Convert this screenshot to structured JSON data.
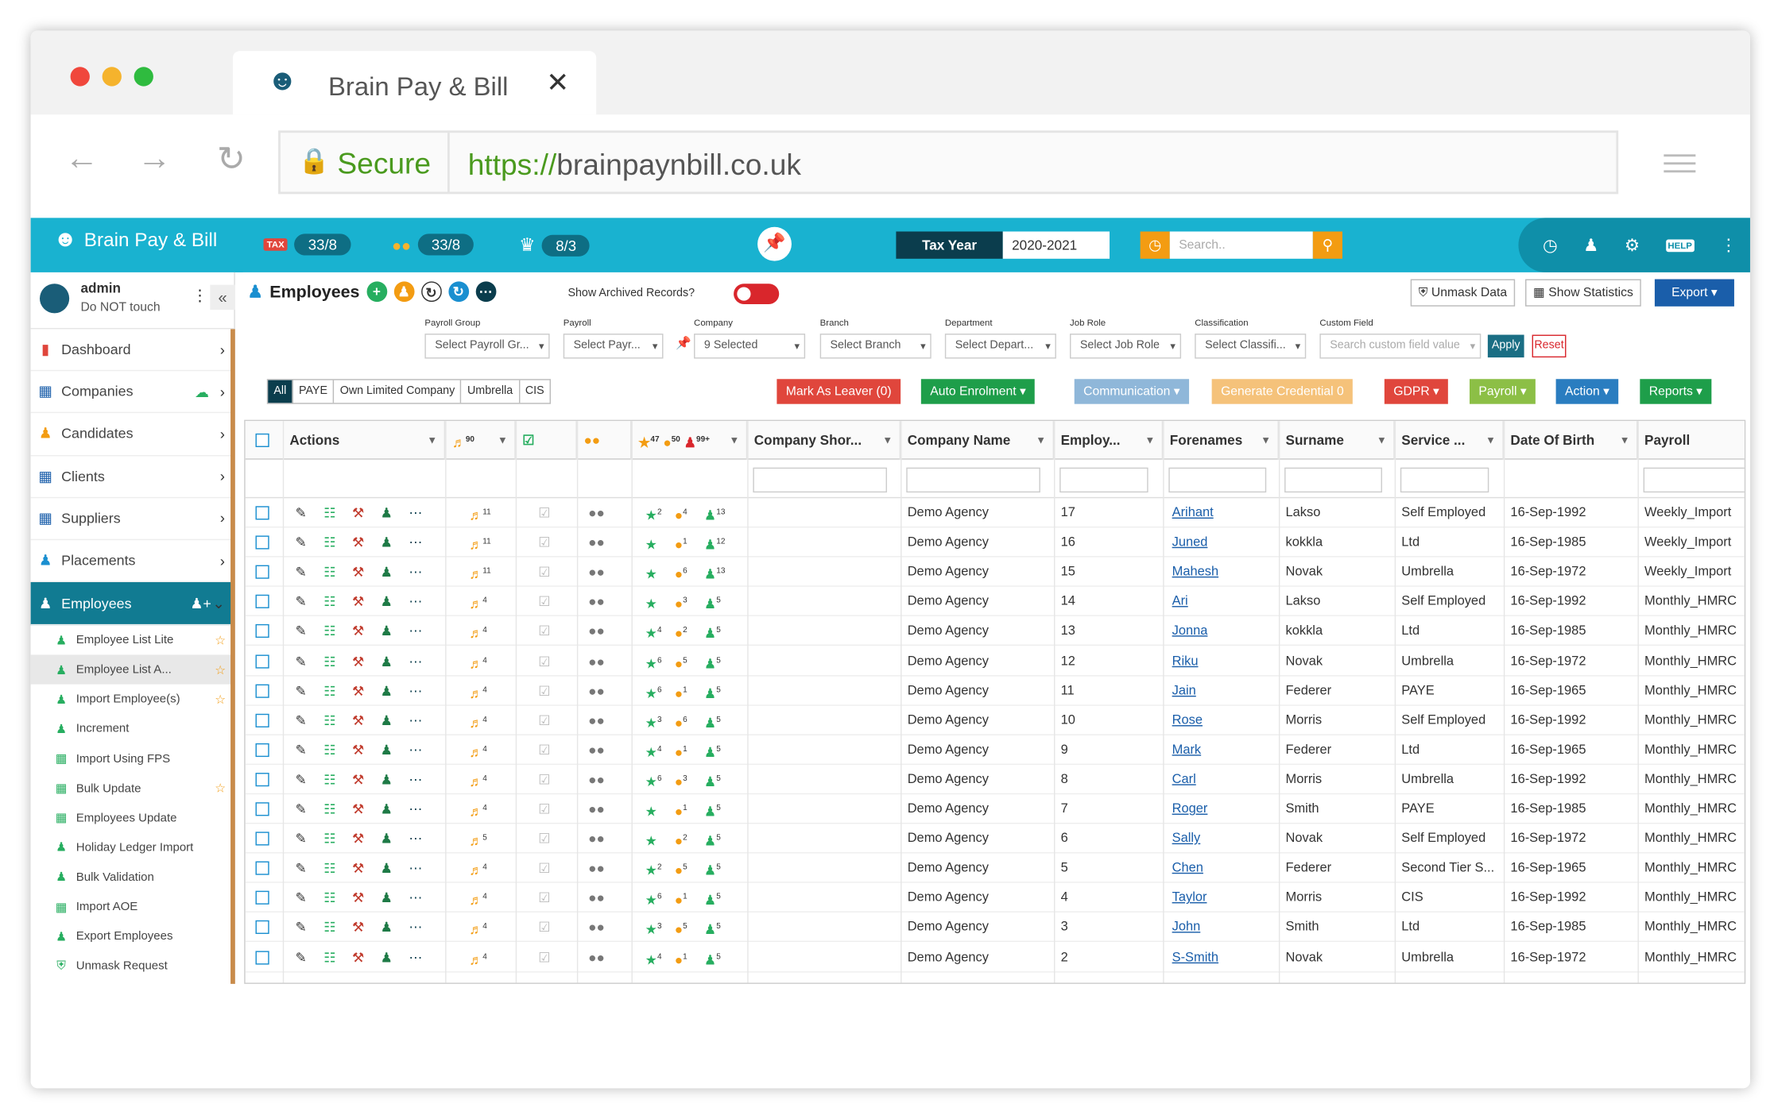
{
  "browser": {
    "tab_title": "Brain Pay & Bill",
    "tab_close": "✕",
    "secure_label": "Secure",
    "url_scheme": "https://",
    "url_host": "brainpaynbill.co.uk"
  },
  "app": {
    "logo_text": "Brain Pay & Bill",
    "counters": [
      {
        "icon": "tax-icon",
        "value": "33/8"
      },
      {
        "icon": "coins-icon",
        "value": "33/8"
      },
      {
        "icon": "crown-icon",
        "value": "8/3"
      }
    ],
    "tax_year_label": "Tax Year",
    "tax_year_value": "2020-2021",
    "search_placeholder": "Search..",
    "top_icons": [
      "timer-icon",
      "user-plus-icon",
      "gear-icon",
      "help-icon",
      "kebab-icon"
    ]
  },
  "user": {
    "name": "admin",
    "role": "Do NOT touch"
  },
  "sidebar": {
    "items": [
      {
        "label": "Dashboard",
        "icon": "chart-icon"
      },
      {
        "label": "Companies",
        "icon": "building-icon"
      },
      {
        "label": "Candidates",
        "icon": "candidates-icon"
      },
      {
        "label": "Clients",
        "icon": "client-icon"
      },
      {
        "label": "Suppliers",
        "icon": "supplier-icon"
      },
      {
        "label": "Placements",
        "icon": "placement-icon"
      },
      {
        "label": "Employees",
        "icon": "employees-icon"
      }
    ],
    "sub_items": [
      {
        "label": "Employee List Lite",
        "star": true
      },
      {
        "label": "Employee List A...",
        "star": true
      },
      {
        "label": "Import Employee(s)",
        "star": true
      },
      {
        "label": "Increment",
        "star": false
      },
      {
        "label": "Import Using FPS",
        "star": false
      },
      {
        "label": "Bulk Update",
        "star": true
      },
      {
        "label": "Employees Update",
        "star": false
      },
      {
        "label": "Holiday Ledger Import",
        "star": false
      },
      {
        "label": "Bulk Validation",
        "star": false
      },
      {
        "label": "Import AOE",
        "star": false
      },
      {
        "label": "Export Employees",
        "star": false
      },
      {
        "label": "Unmask Request",
        "star": false
      }
    ]
  },
  "page": {
    "title": "Employees",
    "archived_label": "Show Archived Records?",
    "unmask_label": "Unmask Data",
    "statistics_label": "Show Statistics",
    "export_label": "Export ▾"
  },
  "filters": [
    {
      "label": "Payroll Group",
      "value": "Select Payroll Gr..."
    },
    {
      "label": "Payroll",
      "value": "Select Payr..."
    },
    {
      "label": "Company",
      "value": "9 Selected"
    },
    {
      "label": "Branch",
      "value": "Select Branch"
    },
    {
      "label": "Department",
      "value": "Select Depart..."
    },
    {
      "label": "Job Role",
      "value": "Select Job Role"
    },
    {
      "label": "Classification",
      "value": "Select Classifi..."
    },
    {
      "label": "Custom Field",
      "value": "Search custom field value"
    }
  ],
  "filter_buttons": {
    "apply": "Apply",
    "reset": "Reset"
  },
  "type_tabs": [
    "All",
    "PAYE",
    "Own Limited Company",
    "Umbrella",
    "CIS"
  ],
  "action_buttons": [
    {
      "label": "Mark As Leaver  (0)",
      "color": "#e0463c"
    },
    {
      "label": "Auto Enrolment ▾",
      "color": "#1e9e4a"
    },
    {
      "label": "Communication ▾",
      "color": "#8fb7d9"
    },
    {
      "label": "Generate Credential  0",
      "color": "#f5c27a"
    },
    {
      "label": "GDPR ▾",
      "color": "#e0463c"
    },
    {
      "label": "Payroll ▾",
      "color": "#8cbf46"
    },
    {
      "label": "Action ▾",
      "color": "#2a7dc0"
    },
    {
      "label": "Reports ▾",
      "color": "#1e9e4a"
    }
  ],
  "table": {
    "columns": [
      "Actions",
      "Company Shor...",
      "Company Name",
      "Employ...",
      "Forenames",
      "Surname",
      "Service ...",
      "Date Of Birth",
      "Payroll"
    ],
    "header_badges": [
      "90",
      "47",
      "50",
      "99+"
    ],
    "rows": [
      {
        "bell": "11",
        "b1": "2",
        "b2": "4",
        "b3": "13",
        "company": "Demo Agency",
        "emp": "17",
        "fore": "Arihant",
        "sur": "Lakso",
        "service": "Self Employed",
        "dob": "16-Sep-1992",
        "payroll": "Weekly_Import"
      },
      {
        "bell": "11",
        "b1": "",
        "b2": "1",
        "b3": "12",
        "company": "Demo Agency",
        "emp": "16",
        "fore": "Juned",
        "sur": "kokkla",
        "service": "Ltd",
        "dob": "16-Sep-1985",
        "payroll": "Weekly_Import"
      },
      {
        "bell": "11",
        "b1": "",
        "b2": "6",
        "b3": "13",
        "company": "Demo Agency",
        "emp": "15",
        "fore": "Mahesh",
        "sur": "Novak",
        "service": "Umbrella",
        "dob": "16-Sep-1972",
        "payroll": "Weekly_Import"
      },
      {
        "bell": "4",
        "b1": "",
        "b2": "3",
        "b3": "5",
        "company": "Demo Agency",
        "emp": "14",
        "fore": "Ari",
        "sur": "Lakso",
        "service": "Self Employed",
        "dob": "16-Sep-1992",
        "payroll": "Monthly_HMRC"
      },
      {
        "bell": "4",
        "b1": "4",
        "b2": "2",
        "b3": "5",
        "company": "Demo Agency",
        "emp": "13",
        "fore": "Jonna",
        "sur": "kokkla",
        "service": "Ltd",
        "dob": "16-Sep-1985",
        "payroll": "Monthly_HMRC"
      },
      {
        "bell": "4",
        "b1": "6",
        "b2": "5",
        "b3": "5",
        "company": "Demo Agency",
        "emp": "12",
        "fore": "Riku",
        "sur": "Novak",
        "service": "Umbrella",
        "dob": "16-Sep-1972",
        "payroll": "Monthly_HMRC"
      },
      {
        "bell": "4",
        "b1": "6",
        "b2": "1",
        "b3": "5",
        "company": "Demo Agency",
        "emp": "11",
        "fore": "Jain",
        "sur": "Federer",
        "service": "PAYE",
        "dob": "16-Sep-1965",
        "payroll": "Monthly_HMRC"
      },
      {
        "bell": "4",
        "b1": "3",
        "b2": "6",
        "b3": "5",
        "company": "Demo Agency",
        "emp": "10",
        "fore": "Rose",
        "sur": "Morris",
        "service": "Self Employed",
        "dob": "16-Sep-1992",
        "payroll": "Monthly_HMRC"
      },
      {
        "bell": "4",
        "b1": "4",
        "b2": "1",
        "b3": "5",
        "company": "Demo Agency",
        "emp": "9",
        "fore": "Mark",
        "sur": "Federer",
        "service": "Ltd",
        "dob": "16-Sep-1965",
        "payroll": "Monthly_HMRC"
      },
      {
        "bell": "4",
        "b1": "6",
        "b2": "3",
        "b3": "5",
        "company": "Demo Agency",
        "emp": "8",
        "fore": "Carl",
        "sur": "Morris",
        "service": "Umbrella",
        "dob": "16-Sep-1992",
        "payroll": "Monthly_HMRC"
      },
      {
        "bell": "4",
        "b1": "",
        "b2": "1",
        "b3": "5",
        "company": "Demo Agency",
        "emp": "7",
        "fore": "Roger",
        "sur": "Smith",
        "service": "PAYE",
        "dob": "16-Sep-1985",
        "payroll": "Monthly_HMRC"
      },
      {
        "bell": "5",
        "b1": "",
        "b2": "2",
        "b3": "5",
        "company": "Demo Agency",
        "emp": "6",
        "fore": "Sally",
        "sur": "Novak",
        "service": "Self Employed",
        "dob": "16-Sep-1972",
        "payroll": "Monthly_HMRC"
      },
      {
        "bell": "4",
        "b1": "2",
        "b2": "5",
        "b3": "5",
        "company": "Demo Agency",
        "emp": "5",
        "fore": "Chen",
        "sur": "Federer",
        "service": "Second Tier S...",
        "dob": "16-Sep-1965",
        "payroll": "Monthly_HMRC"
      },
      {
        "bell": "4",
        "b1": "6",
        "b2": "1",
        "b3": "5",
        "company": "Demo Agency",
        "emp": "4",
        "fore": "Taylor",
        "sur": "Morris",
        "service": "CIS",
        "dob": "16-Sep-1992",
        "payroll": "Monthly_HMRC"
      },
      {
        "bell": "4",
        "b1": "3",
        "b2": "5",
        "b3": "5",
        "company": "Demo Agency",
        "emp": "3",
        "fore": "John",
        "sur": "Smith",
        "service": "Ltd",
        "dob": "16-Sep-1985",
        "payroll": "Monthly_HMRC"
      },
      {
        "bell": "4",
        "b1": "4",
        "b2": "1",
        "b3": "5",
        "company": "Demo Agency",
        "emp": "2",
        "fore": "S-Smith",
        "sur": "Novak",
        "service": "Umbrella",
        "dob": "16-Sep-1972",
        "payroll": "Monthly_HMRC"
      }
    ]
  }
}
